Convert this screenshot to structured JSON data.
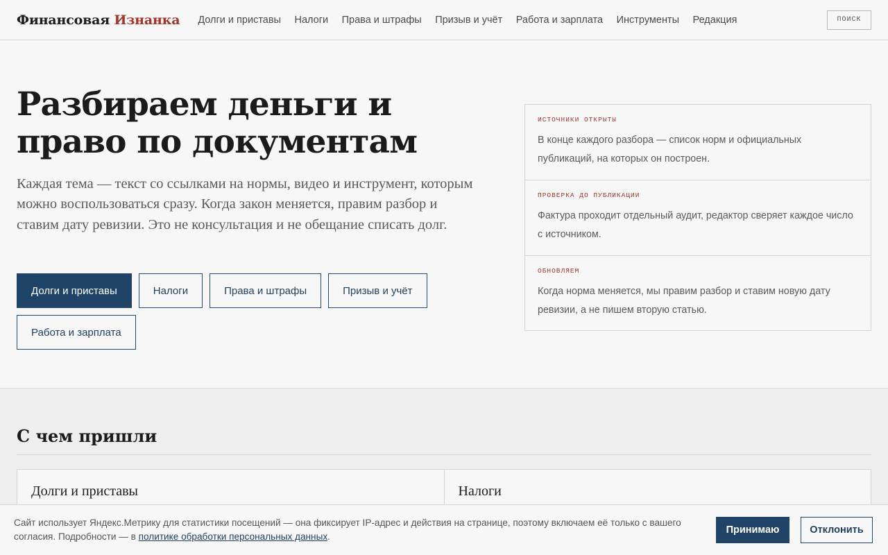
{
  "header": {
    "logo_main": "Финансовая",
    "logo_accent": "Изнанка",
    "nav": [
      "Долги и приставы",
      "Налоги",
      "Права и штрафы",
      "Призыв и учёт",
      "Работа и зарплата",
      "Инструменты",
      "Редакция"
    ],
    "search_label": "ПОИСК"
  },
  "hero": {
    "title": "Разбираем деньги и право по документам",
    "lead": "Каждая тема — текст со ссылками на нормы, видео и инструмент, которым можно воспользоваться сразу. Когда закон меняется, правим разбор и ставим дату ревизии. Это не консультация и не обещание списать долг.",
    "topics": [
      "Долги и приставы",
      "Налоги",
      "Права и штрафы",
      "Призыв и учёт",
      "Работа и зарплата"
    ],
    "active_topic": "Долги и приставы"
  },
  "facts": [
    {
      "label": "ИСТОЧНИКИ ОТКРЫТЫ",
      "text": "В конце каждого разбора — список норм и официальных публикаций, на которых он построен."
    },
    {
      "label": "ПРОВЕРКА ДО ПУБЛИКАЦИИ",
      "text": "Фактура проходит отдельный аудит, редактор сверяет каждое число с источником."
    },
    {
      "label": "ОБНОВЛЯЕМ",
      "text": "Когда норма меняется, мы правим разбор и ставим новую дату ревизии, а не пишем вторую статью."
    }
  ],
  "section": {
    "title": "С чем пришли",
    "cards": [
      "Долги и приставы",
      "Налоги"
    ]
  },
  "cookie": {
    "text_before": "Сайт использует Яндекс.Метрику для статистики посещений — она фиксирует IP-адрес и действия на странице, поэтому включаем её только с вашего согласия. Подробности — в ",
    "link": "политике обработки персональных данных",
    "text_after": ".",
    "accept": "Принимаю",
    "decline": "Отклонить"
  },
  "colors": {
    "accent_red": "#a6352c",
    "primary_blue": "#1f4468",
    "background": "#f7f7f7"
  }
}
